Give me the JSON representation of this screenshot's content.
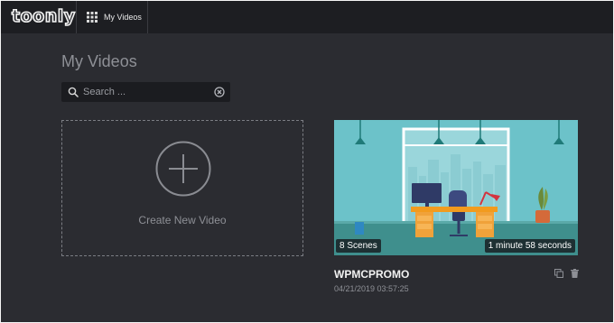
{
  "header": {
    "logo_text": "toonly",
    "nav_label": "My Videos"
  },
  "page": {
    "title": "My Videos"
  },
  "search": {
    "placeholder": "Search ..."
  },
  "create_card": {
    "label": "Create New Video"
  },
  "videos": [
    {
      "title": "WPMCPROMO",
      "date": "04/21/2019 03:57:25",
      "scenes": "8 Scenes",
      "duration": "1 minute 58 seconds"
    }
  ],
  "colors": {
    "background": "#2b2c31",
    "topbar": "#1d1e22",
    "thumbnail_sky": "#6cc2c9",
    "desk": "#f29b1e"
  },
  "icons": {
    "nav": "grid-icon",
    "search": "search-icon",
    "clear": "clear-icon",
    "create": "plus-circle-icon",
    "duplicate": "copy-icon",
    "delete": "trash-icon"
  }
}
